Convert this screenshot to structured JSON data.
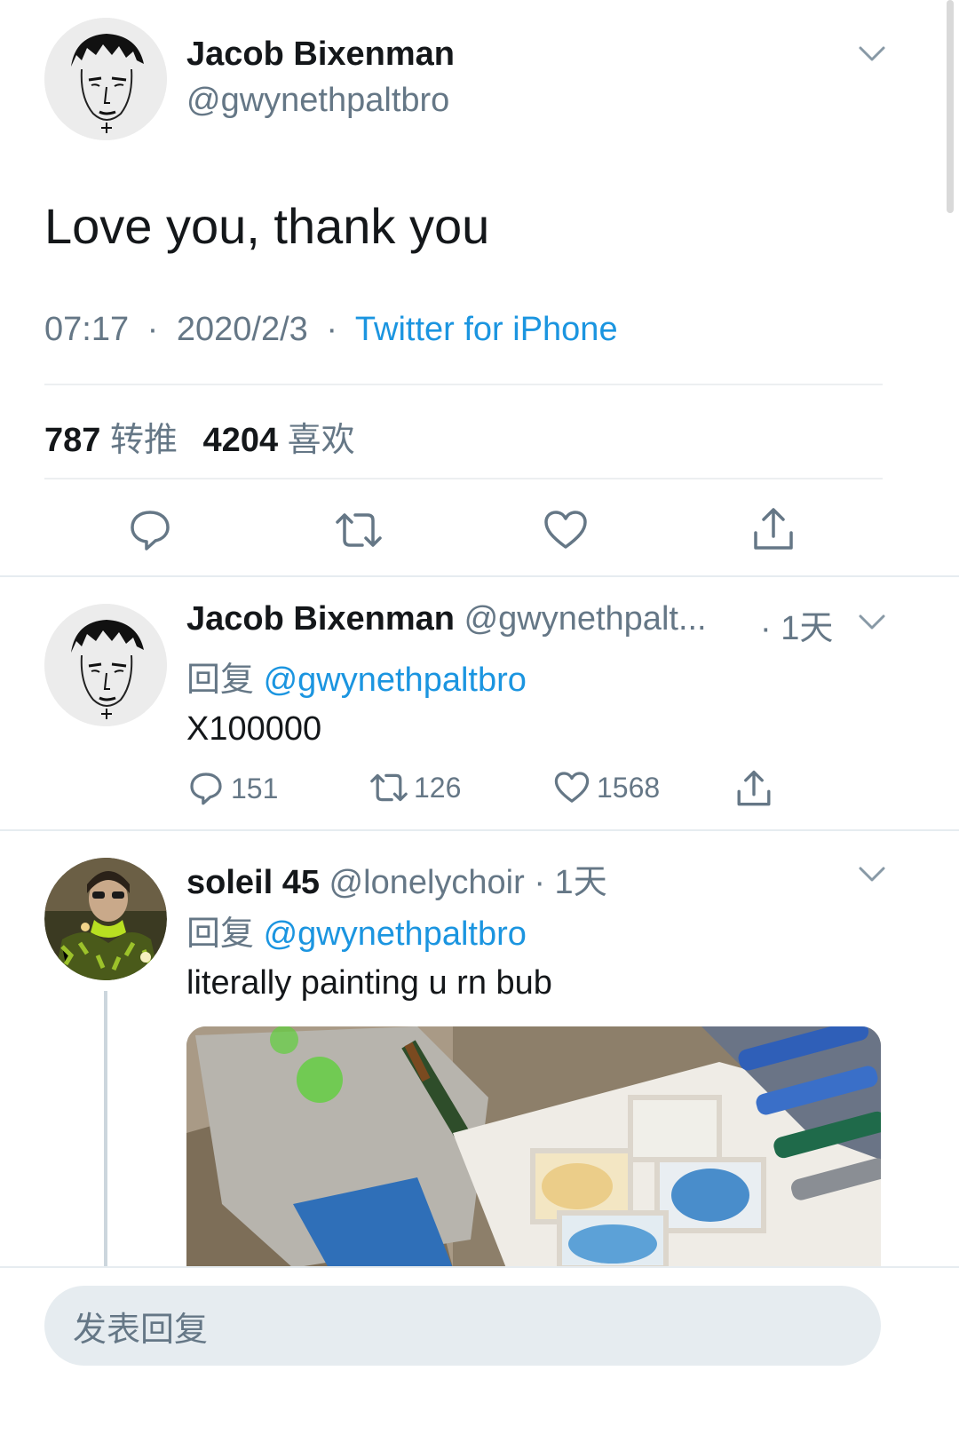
{
  "main_tweet": {
    "display_name": "Jacob Bixenman",
    "handle": "@gwynethpaltbro",
    "text": "Love you, thank you",
    "time": "07:17",
    "date": "2020/2/3",
    "separator": "·",
    "source": "Twitter for iPhone",
    "retweets_count": "787",
    "retweets_label": "转推",
    "likes_count": "4204",
    "likes_label": "喜欢"
  },
  "replies": [
    {
      "display_name": "Jacob Bixenman",
      "handle": "@gwynethpalt...",
      "age": "· 1天",
      "reply_prefix": "回复",
      "reply_to": "@gwynethpaltbro",
      "text": "X100000",
      "comments": "151",
      "retweets": "126",
      "likes": "1568"
    },
    {
      "display_name": "soleil 45",
      "handle": "@lonelychoir",
      "age": "· 1天",
      "reply_prefix": "回复",
      "reply_to": "@gwynethpaltbro",
      "text": "literally painting u rn bub"
    }
  ],
  "composer": {
    "placeholder": "发表回复"
  },
  "colors": {
    "link": "#1b95e0",
    "secondary_text": "#657786",
    "divider": "#e6ecf0"
  },
  "icons": [
    "avatar-sketch",
    "chevron-down-icon",
    "comment-icon",
    "retweet-icon",
    "heart-icon",
    "share-icon"
  ]
}
